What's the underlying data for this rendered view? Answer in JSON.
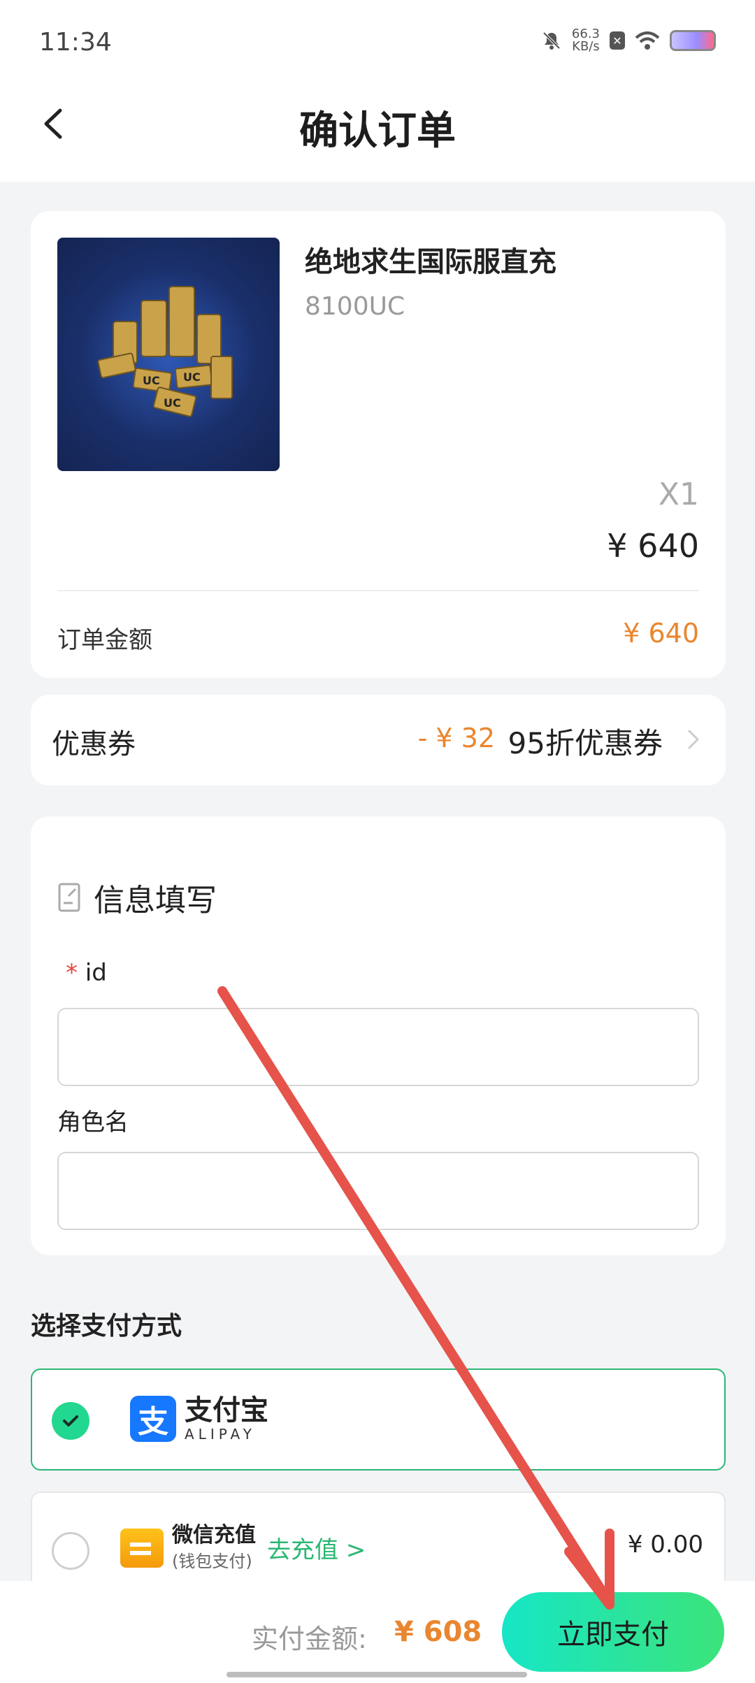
{
  "status_bar": {
    "time": "11:34",
    "net_speed_value": "66.3",
    "net_speed_unit": "KB/s"
  },
  "header": {
    "title": "确认订单"
  },
  "product": {
    "name": "绝地求生国际服直充",
    "spec": "8100UC",
    "quantity": "X1",
    "price": "¥ 640",
    "order_amount_label": "订单金额",
    "order_amount": "¥ 640"
  },
  "coupon": {
    "label": "优惠券",
    "discount": "- ¥ 32",
    "name": "95折优惠券"
  },
  "info": {
    "title": "信息填写",
    "required_mark": "*",
    "id_label": "id",
    "id_value": "",
    "role_label": "角色名",
    "role_value": ""
  },
  "payment": {
    "title": "选择支付方式",
    "alipay_cn": "支付宝",
    "alipay_en": "ALIPAY",
    "alipay_selected": true,
    "wechat_name": "微信充值",
    "wechat_sub": "(钱包支付)",
    "recharge_link": "去充值 >",
    "wechat_balance": "¥ 0.00"
  },
  "bottom": {
    "pay_amount_label": "实付金额:",
    "pay_amount": "¥ 608",
    "pay_button": "立即支付"
  },
  "colors": {
    "accent_orange": "#e9862f",
    "accent_green": "#2bb673",
    "annotation_arrow": "#e5534b"
  }
}
